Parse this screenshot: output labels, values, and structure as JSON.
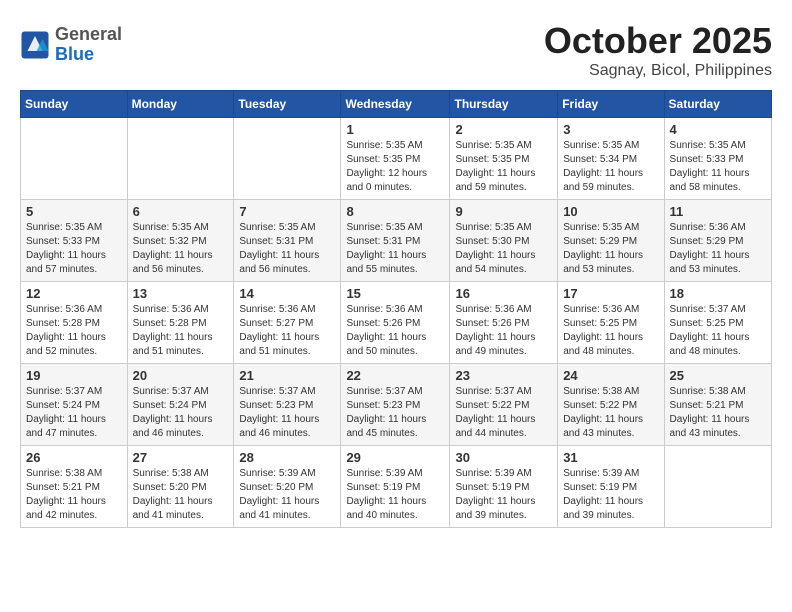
{
  "header": {
    "logo_general": "General",
    "logo_blue": "Blue",
    "month_title": "October 2025",
    "location": "Sagnay, Bicol, Philippines"
  },
  "weekdays": [
    "Sunday",
    "Monday",
    "Tuesday",
    "Wednesday",
    "Thursday",
    "Friday",
    "Saturday"
  ],
  "weeks": [
    [
      {
        "day": "",
        "info": ""
      },
      {
        "day": "",
        "info": ""
      },
      {
        "day": "",
        "info": ""
      },
      {
        "day": "1",
        "info": "Sunrise: 5:35 AM\nSunset: 5:35 PM\nDaylight: 12 hours and 0 minutes."
      },
      {
        "day": "2",
        "info": "Sunrise: 5:35 AM\nSunset: 5:35 PM\nDaylight: 11 hours and 59 minutes."
      },
      {
        "day": "3",
        "info": "Sunrise: 5:35 AM\nSunset: 5:34 PM\nDaylight: 11 hours and 59 minutes."
      },
      {
        "day": "4",
        "info": "Sunrise: 5:35 AM\nSunset: 5:33 PM\nDaylight: 11 hours and 58 minutes."
      }
    ],
    [
      {
        "day": "5",
        "info": "Sunrise: 5:35 AM\nSunset: 5:33 PM\nDaylight: 11 hours and 57 minutes."
      },
      {
        "day": "6",
        "info": "Sunrise: 5:35 AM\nSunset: 5:32 PM\nDaylight: 11 hours and 56 minutes."
      },
      {
        "day": "7",
        "info": "Sunrise: 5:35 AM\nSunset: 5:31 PM\nDaylight: 11 hours and 56 minutes."
      },
      {
        "day": "8",
        "info": "Sunrise: 5:35 AM\nSunset: 5:31 PM\nDaylight: 11 hours and 55 minutes."
      },
      {
        "day": "9",
        "info": "Sunrise: 5:35 AM\nSunset: 5:30 PM\nDaylight: 11 hours and 54 minutes."
      },
      {
        "day": "10",
        "info": "Sunrise: 5:35 AM\nSunset: 5:29 PM\nDaylight: 11 hours and 53 minutes."
      },
      {
        "day": "11",
        "info": "Sunrise: 5:36 AM\nSunset: 5:29 PM\nDaylight: 11 hours and 53 minutes."
      }
    ],
    [
      {
        "day": "12",
        "info": "Sunrise: 5:36 AM\nSunset: 5:28 PM\nDaylight: 11 hours and 52 minutes."
      },
      {
        "day": "13",
        "info": "Sunrise: 5:36 AM\nSunset: 5:28 PM\nDaylight: 11 hours and 51 minutes."
      },
      {
        "day": "14",
        "info": "Sunrise: 5:36 AM\nSunset: 5:27 PM\nDaylight: 11 hours and 51 minutes."
      },
      {
        "day": "15",
        "info": "Sunrise: 5:36 AM\nSunset: 5:26 PM\nDaylight: 11 hours and 50 minutes."
      },
      {
        "day": "16",
        "info": "Sunrise: 5:36 AM\nSunset: 5:26 PM\nDaylight: 11 hours and 49 minutes."
      },
      {
        "day": "17",
        "info": "Sunrise: 5:36 AM\nSunset: 5:25 PM\nDaylight: 11 hours and 48 minutes."
      },
      {
        "day": "18",
        "info": "Sunrise: 5:37 AM\nSunset: 5:25 PM\nDaylight: 11 hours and 48 minutes."
      }
    ],
    [
      {
        "day": "19",
        "info": "Sunrise: 5:37 AM\nSunset: 5:24 PM\nDaylight: 11 hours and 47 minutes."
      },
      {
        "day": "20",
        "info": "Sunrise: 5:37 AM\nSunset: 5:24 PM\nDaylight: 11 hours and 46 minutes."
      },
      {
        "day": "21",
        "info": "Sunrise: 5:37 AM\nSunset: 5:23 PM\nDaylight: 11 hours and 46 minutes."
      },
      {
        "day": "22",
        "info": "Sunrise: 5:37 AM\nSunset: 5:23 PM\nDaylight: 11 hours and 45 minutes."
      },
      {
        "day": "23",
        "info": "Sunrise: 5:37 AM\nSunset: 5:22 PM\nDaylight: 11 hours and 44 minutes."
      },
      {
        "day": "24",
        "info": "Sunrise: 5:38 AM\nSunset: 5:22 PM\nDaylight: 11 hours and 43 minutes."
      },
      {
        "day": "25",
        "info": "Sunrise: 5:38 AM\nSunset: 5:21 PM\nDaylight: 11 hours and 43 minutes."
      }
    ],
    [
      {
        "day": "26",
        "info": "Sunrise: 5:38 AM\nSunset: 5:21 PM\nDaylight: 11 hours and 42 minutes."
      },
      {
        "day": "27",
        "info": "Sunrise: 5:38 AM\nSunset: 5:20 PM\nDaylight: 11 hours and 41 minutes."
      },
      {
        "day": "28",
        "info": "Sunrise: 5:39 AM\nSunset: 5:20 PM\nDaylight: 11 hours and 41 minutes."
      },
      {
        "day": "29",
        "info": "Sunrise: 5:39 AM\nSunset: 5:19 PM\nDaylight: 11 hours and 40 minutes."
      },
      {
        "day": "30",
        "info": "Sunrise: 5:39 AM\nSunset: 5:19 PM\nDaylight: 11 hours and 39 minutes."
      },
      {
        "day": "31",
        "info": "Sunrise: 5:39 AM\nSunset: 5:19 PM\nDaylight: 11 hours and 39 minutes."
      },
      {
        "day": "",
        "info": ""
      }
    ]
  ]
}
